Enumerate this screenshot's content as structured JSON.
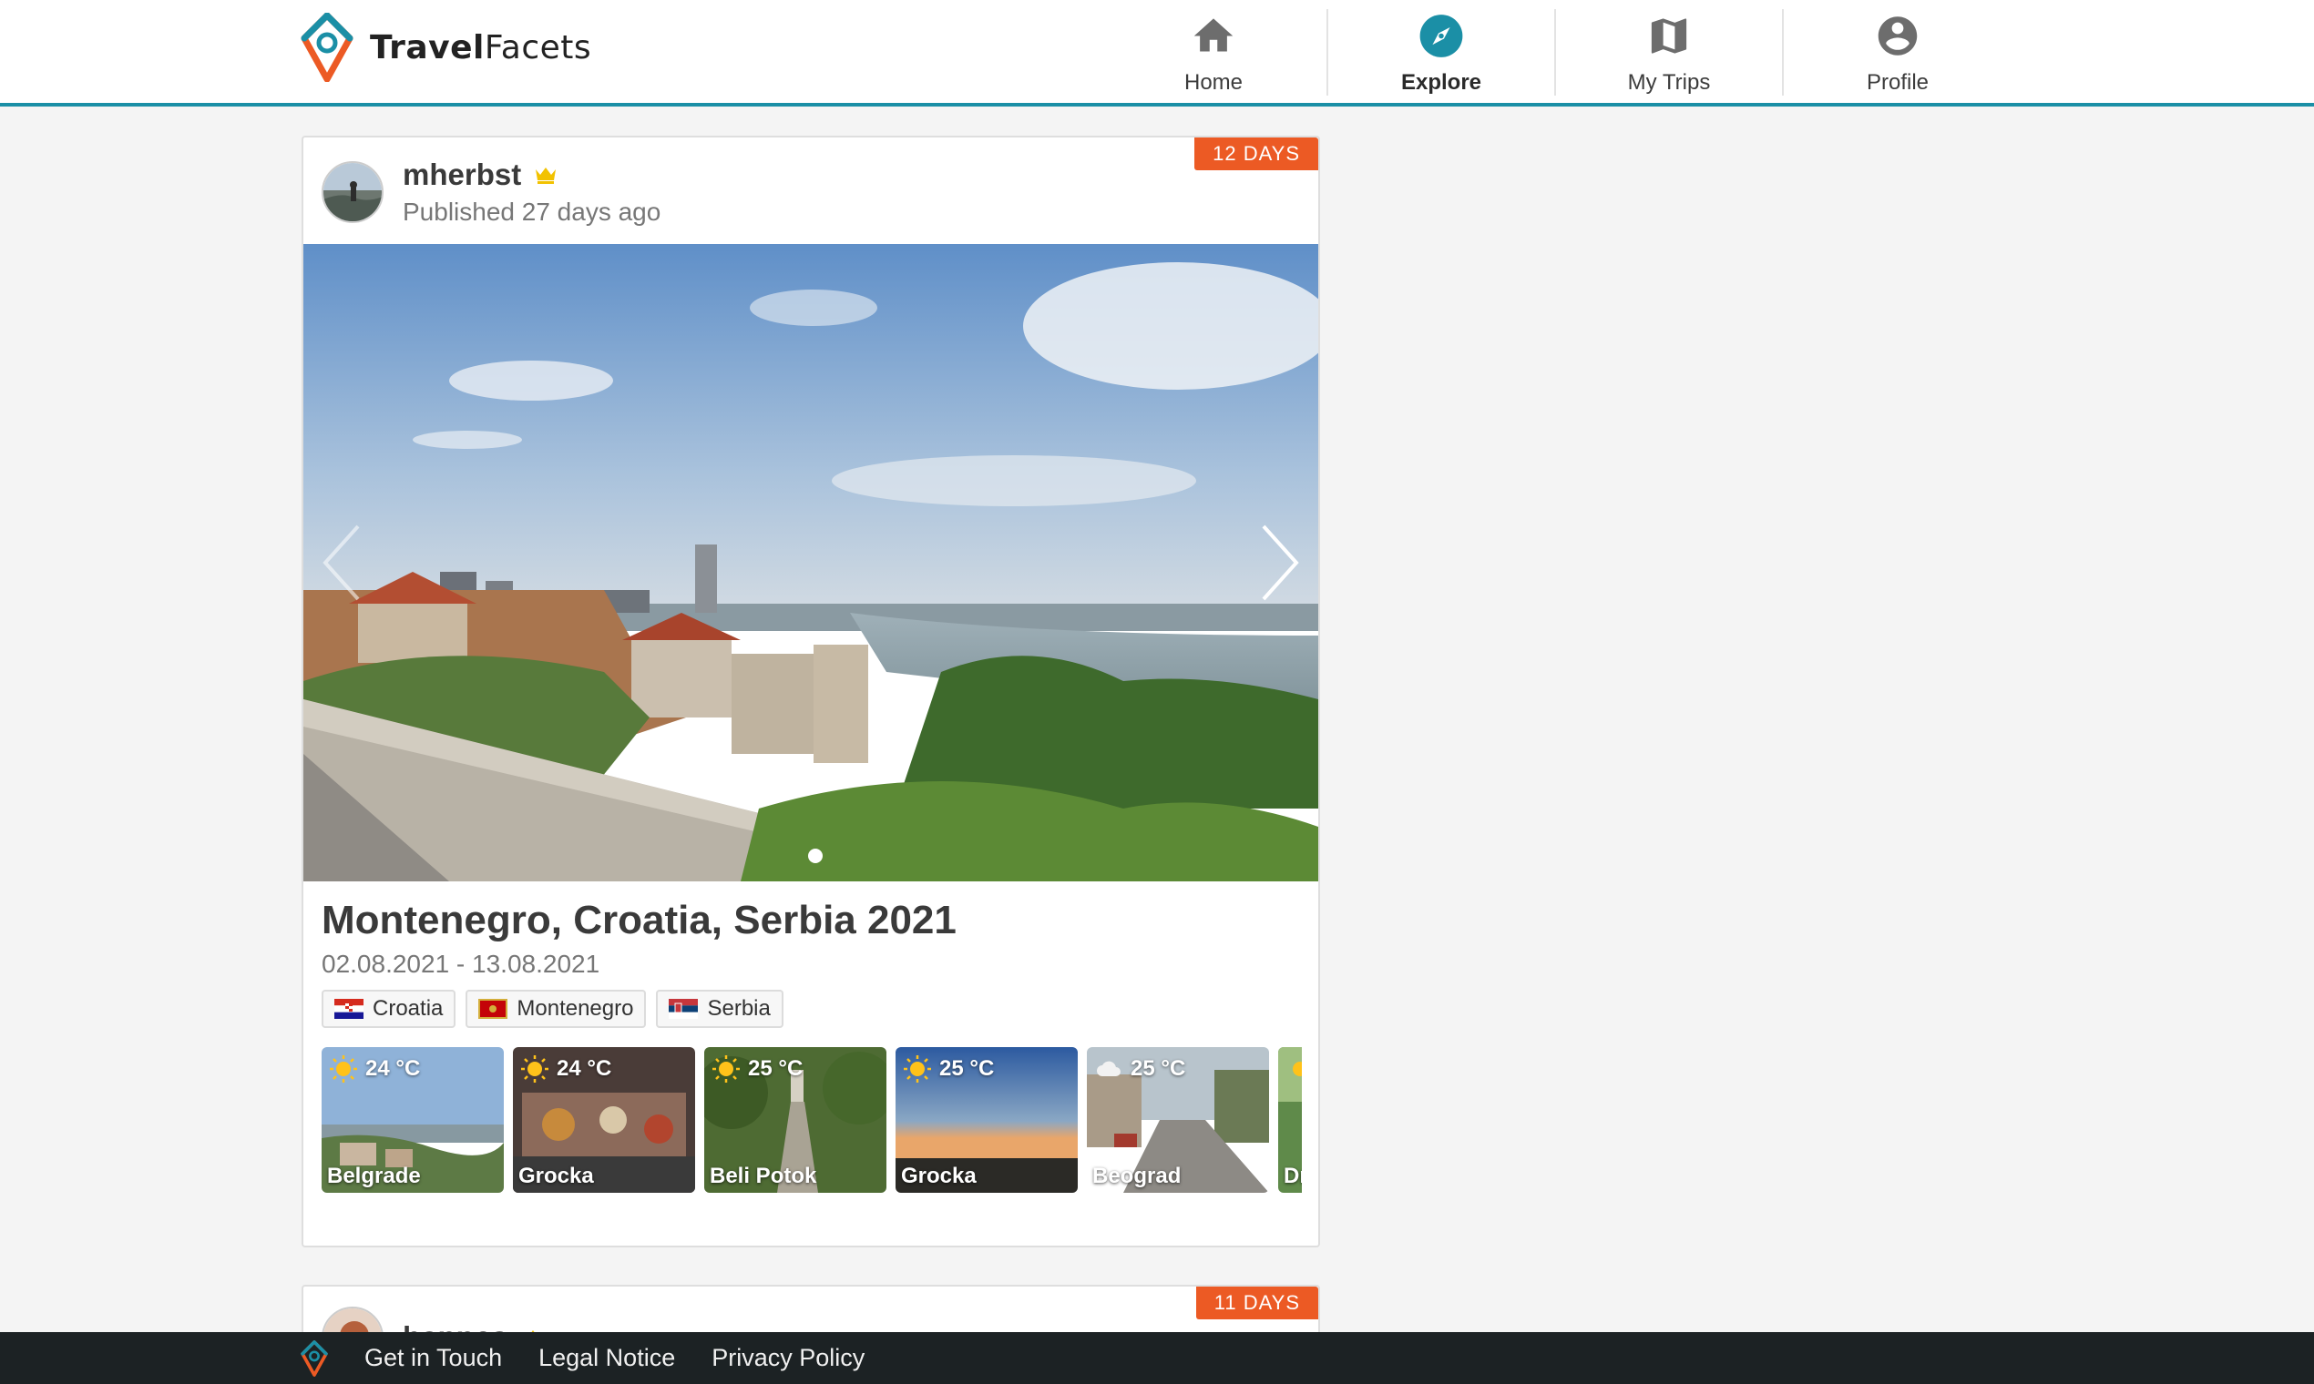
{
  "app": {
    "name_bold": "Travel",
    "name_rest": "Facets",
    "accent_color": "#1b8fa6",
    "badge_color": "#ec5a24"
  },
  "nav": {
    "items": [
      {
        "label": "Home",
        "icon": "home-icon",
        "active": false
      },
      {
        "label": "Explore",
        "icon": "compass-icon",
        "active": true
      },
      {
        "label": "My Trips",
        "icon": "map-icon",
        "active": false
      },
      {
        "label": "Profile",
        "icon": "account-circle-icon",
        "active": false
      }
    ]
  },
  "feed": [
    {
      "duration_badge": "12 DAYS",
      "author": "mherbst",
      "author_badge_icon": "crown-icon",
      "published": "Published 27 days ago",
      "title": "Montenegro, Croatia, Serbia 2021",
      "dates": "02.08.2021 - 13.08.2021",
      "countries": [
        {
          "name": "Croatia",
          "flag": "croatia-flag"
        },
        {
          "name": "Montenegro",
          "flag": "montenegro-flag"
        },
        {
          "name": "Serbia",
          "flag": "serbia-flag"
        }
      ],
      "photo_pages": 1,
      "facets": [
        {
          "temp": "24 °C",
          "weather": "sunny",
          "place": "Belgrade"
        },
        {
          "temp": "24 °C",
          "weather": "sunny",
          "place": "Grocka"
        },
        {
          "temp": "25 °C",
          "weather": "sunny",
          "place": "Beli Potok"
        },
        {
          "temp": "25 °C",
          "weather": "sunny",
          "place": "Grocka"
        },
        {
          "temp": "25 °C",
          "weather": "cloudy",
          "place": "Beograd"
        },
        {
          "temp": "",
          "weather": "sunny",
          "place": "Dr"
        }
      ]
    },
    {
      "duration_badge": "11 DAYS",
      "author": "hannes",
      "author_badge_icon": "crown-icon"
    }
  ],
  "footer": {
    "links": [
      "Get in Touch",
      "Legal Notice",
      "Privacy Policy"
    ]
  }
}
